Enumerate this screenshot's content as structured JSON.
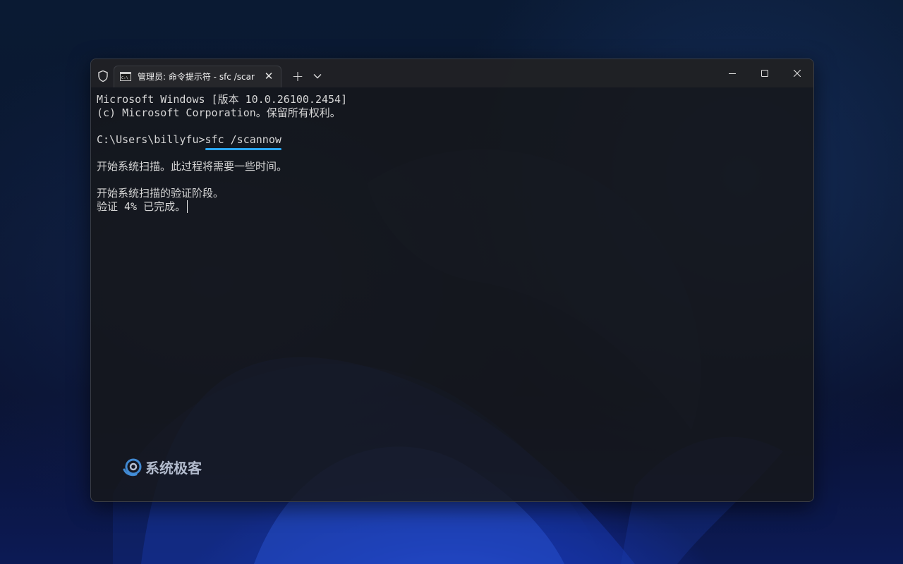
{
  "window": {
    "shield_icon": "shield-icon",
    "tab": {
      "icon": "cmd-icon",
      "title": "管理员: 命令提示符 - sfc  /scar",
      "close_glyph": "✕"
    },
    "new_tab_glyph": "+",
    "dropdown_icon": "chevron-down-icon",
    "controls": {
      "minimize_icon": "minimize-icon",
      "maximize_icon": "maximize-icon",
      "close_icon": "close-icon"
    }
  },
  "console": {
    "lines": [
      "Microsoft Windows [版本 10.0.26100.2454]",
      "(c) Microsoft Corporation。保留所有权利。",
      "",
      "",
      "",
      "开始系统扫描。此过程将需要一些时间。",
      "",
      "开始系统扫描的验证阶段。",
      "验证 4% 已完成。"
    ],
    "prompt": "C:\\Users\\billyfu>",
    "command": "sfc /scannow"
  },
  "watermark": {
    "text": "系统极客"
  },
  "colors": {
    "accent_underline": "#2aa6f0",
    "terminal_text": "#d6d6d6",
    "titlebar": "#202125"
  }
}
